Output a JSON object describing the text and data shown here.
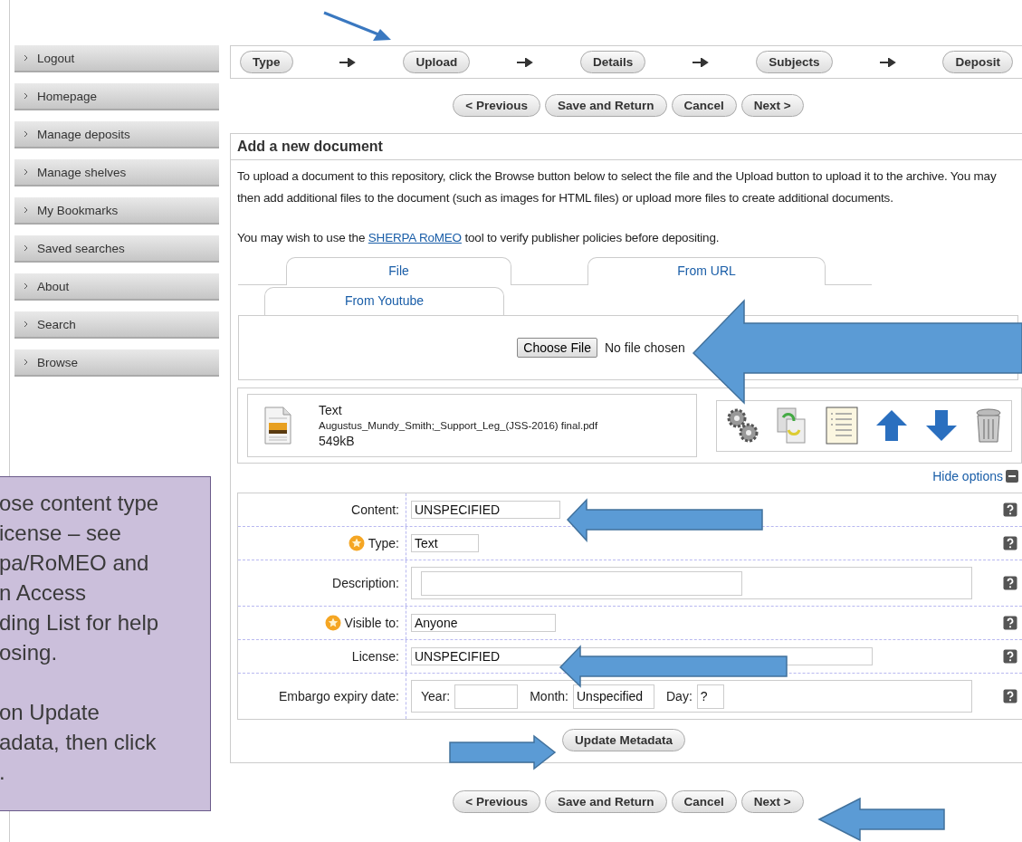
{
  "sidebar": {
    "items": [
      {
        "label": "Logout"
      },
      {
        "label": "Homepage"
      },
      {
        "label": "Manage deposits"
      },
      {
        "label": "Manage shelves"
      },
      {
        "label": "My Bookmarks"
      },
      {
        "label": "Saved searches"
      },
      {
        "label": "About"
      },
      {
        "label": "Search"
      },
      {
        "label": "Browse"
      }
    ]
  },
  "steps": [
    {
      "label": "Type"
    },
    {
      "label": "Upload"
    },
    {
      "label": "Details"
    },
    {
      "label": "Subjects"
    },
    {
      "label": "Deposit"
    }
  ],
  "nav_top": [
    "< Previous",
    "Save and Return",
    "Cancel",
    "Next >"
  ],
  "panel": {
    "title": "Add a new document",
    "intro": "To upload a document to this repository, click the Browse button below to select the file and the Upload button to upload it to the archive. You may then add additional files to the document (such as images for HTML files) or upload more files to create additional documents.",
    "hint_before": "You may wish to use the ",
    "hint_link": "SHERPA RoMEO",
    "hint_after": " tool to verify publisher policies before depositing.",
    "tabs": [
      {
        "label": "File"
      },
      {
        "label": "From URL"
      },
      {
        "label": "From Youtube"
      }
    ],
    "file_button": "Choose File",
    "file_status": "No file chosen"
  },
  "document": {
    "type": "Text",
    "filename": "Augustus_Mundy_Smith;_Support_Leg_(JSS-2016) final.pdf",
    "size": "549kB"
  },
  "hide_options": "Hide options",
  "fields": [
    {
      "kind": "text",
      "label": "Content:",
      "required": false,
      "value": "UNSPECIFIED"
    },
    {
      "kind": "text",
      "label": "Type:",
      "required": true,
      "value": "Text"
    },
    {
      "kind": "area",
      "label": "Description:",
      "required": false
    },
    {
      "kind": "text",
      "label": "Visible to:",
      "required": true,
      "value": "Anyone"
    },
    {
      "kind": "text",
      "label": "License:",
      "required": false,
      "value": "UNSPECIFIED"
    },
    {
      "kind": "date",
      "label": "Embargo expiry date:",
      "required": false,
      "parts": [
        {
          "label": "Year:"
        },
        {
          "label": "Month:",
          "value": "Unspecified"
        },
        {
          "label": "Day:",
          "value": "?"
        }
      ]
    }
  ],
  "update_button": "Update Metadata",
  "nav_bottom": [
    "< Previous",
    "Save and Return",
    "Cancel",
    "Next >"
  ],
  "callout": {
    "paragraphs": [
      "ose content type\nicense – see\npa/RoMEO and\nn Access\nding List for help\nosing.",
      "on Update\nadata, then click\n."
    ]
  }
}
